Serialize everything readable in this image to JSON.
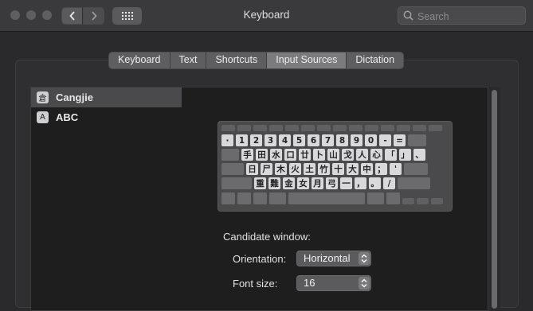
{
  "window": {
    "title": "Keyboard"
  },
  "search": {
    "placeholder": "Search"
  },
  "tabs": [
    {
      "label": "Keyboard"
    },
    {
      "label": "Text"
    },
    {
      "label": "Shortcuts"
    },
    {
      "label": "Input Sources",
      "active": true
    },
    {
      "label": "Dictation"
    }
  ],
  "input_sources": [
    {
      "icon_char": "倉",
      "label": "Cangjie",
      "selected": true
    },
    {
      "icon_char": "A",
      "label": "ABC",
      "selected": false
    }
  ],
  "keyboard_rows": [
    [
      "·",
      "1",
      "2",
      "3",
      "4",
      "5",
      "6",
      "7",
      "8",
      "9",
      "0",
      "-",
      "="
    ],
    [
      "手",
      "田",
      "水",
      "口",
      "廿",
      "卜",
      "山",
      "戈",
      "人",
      "心",
      "「",
      "」",
      "、"
    ],
    [
      "日",
      "尸",
      "木",
      "火",
      "土",
      "竹",
      "十",
      "大",
      "中",
      "；",
      "'"
    ],
    [
      "重",
      "難",
      "金",
      "女",
      "月",
      "弓",
      "一",
      "，",
      "。",
      "/"
    ]
  ],
  "candidate": {
    "title": "Candidate window:",
    "orientation_label": "Orientation:",
    "orientation_value": "Horizontal",
    "font_size_label": "Font size:",
    "font_size_value": "16"
  },
  "colors": {
    "accent_selected": "#4a4a4c",
    "key_lit": "#d9d9db"
  }
}
